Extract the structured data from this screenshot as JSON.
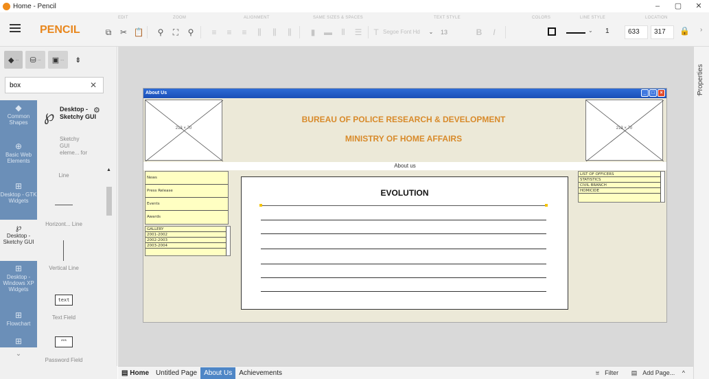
{
  "window": {
    "title": "Home - Pencil",
    "controls": [
      "–",
      "▢",
      "✕"
    ]
  },
  "toolbar": {
    "brand": "PENCIL",
    "groups": [
      "EDIT",
      "ZOOM",
      "ALIGNMENT",
      "SAME SIZES & SPACES",
      "TEXT STYLE",
      "COLORS",
      "LINE STYLE",
      "LOCATION"
    ],
    "font_name": "Segoe Font Hd",
    "font_size": "13",
    "line_width": "1",
    "loc_x": "633",
    "loc_y": "317"
  },
  "left_panel": {
    "tabs": [
      {
        "icon": "layers-icon",
        "glyph": "◆",
        "suffix": "..."
      },
      {
        "icon": "briefcase-icon",
        "glyph": "⛁",
        "suffix": "..."
      },
      {
        "icon": "image-icon",
        "glyph": "▣",
        "suffix": "..."
      },
      {
        "icon": "pin-icon",
        "glyph": "⇟",
        "suffix": ""
      }
    ],
    "search": {
      "value": "box",
      "placeholder": ""
    },
    "categories": [
      {
        "label": "Common Shapes",
        "glyph": "◆"
      },
      {
        "label": "Basic Web Elements",
        "glyph": "⊕"
      },
      {
        "label": "Desktop - GTK Widgets",
        "glyph": "⊞"
      },
      {
        "label": "Desktop - Sketchy GUI",
        "glyph": "℘"
      },
      {
        "label": "Desktop - Windows XP Widgets",
        "glyph": "⊞"
      },
      {
        "label": "Flowchart",
        "glyph": "⊞"
      }
    ],
    "collection_title": "Desktop - Sketchy GUI",
    "collection_desc": "Sketchy GUI eleme... for",
    "shapes": [
      "Line",
      "Horizont... Line",
      "Vertical Line",
      "Text Field",
      "Password Field"
    ],
    "text_field_sample": "text",
    "password_sample": "***"
  },
  "right_bar": {
    "label": "Properties"
  },
  "mockup": {
    "window_title": "About Us",
    "placeholder_dims": "213 × 70",
    "header_line1": "BUREAU OF POLICE RESEARCH & DEVELOPMENT",
    "header_line2": "MINISTRY OF HOME AFFAIRS",
    "about_label": "About us",
    "nav_items": [
      "News",
      "Press Release",
      "Events",
      "Awards"
    ],
    "gallery_items": [
      "GALLERY",
      "2001-2002",
      "2002-2003",
      "2003-2004"
    ],
    "side_items": [
      "LIST OF OFFICERS",
      "STATISTICS",
      "CIVIL BRANCH",
      "HOMICIDE"
    ],
    "panel_title": "EVOLUTION"
  },
  "bottom_bar": {
    "home": "Home",
    "pages": [
      "Untitled Page",
      "About Us",
      "Achievements"
    ],
    "active_page": "About Us",
    "filter": "Filter",
    "add_page": "Add Page...",
    "more": "^"
  },
  "colors": {
    "brand": "#e8861c",
    "category_blue": "#6b8fb8",
    "active_tab": "#4e86c6",
    "mockup_header": "#d88a2a"
  }
}
